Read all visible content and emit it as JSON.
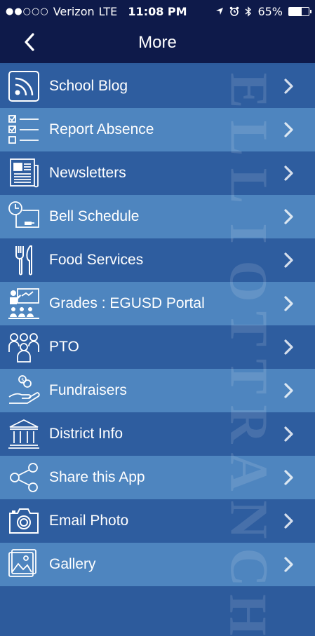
{
  "status_bar": {
    "carrier": "Verizon",
    "network": "LTE",
    "time": "11:08 PM",
    "battery": "65%",
    "battery_level": 0.65
  },
  "nav": {
    "title": "More"
  },
  "watermark": [
    "E",
    "L",
    "L",
    "I",
    "O",
    "T",
    "T",
    "R",
    "A",
    "N",
    "C",
    "H"
  ],
  "items": [
    {
      "label": "School Blog",
      "icon": "rss-icon"
    },
    {
      "label": "Report Absence",
      "icon": "checklist-icon"
    },
    {
      "label": "Newsletters",
      "icon": "newspaper-icon"
    },
    {
      "label": "Bell Schedule",
      "icon": "clock-board-icon"
    },
    {
      "label": "Food Services",
      "icon": "fork-knife-icon"
    },
    {
      "label": "Grades : EGUSD Portal",
      "icon": "classroom-icon"
    },
    {
      "label": "PTO",
      "icon": "people-icon"
    },
    {
      "label": "Fundraisers",
      "icon": "hand-coins-icon"
    },
    {
      "label": "District Info",
      "icon": "building-icon"
    },
    {
      "label": "Share this App",
      "icon": "share-icon"
    },
    {
      "label": "Email Photo",
      "icon": "camera-icon"
    },
    {
      "label": "Gallery",
      "icon": "gallery-icon"
    }
  ]
}
